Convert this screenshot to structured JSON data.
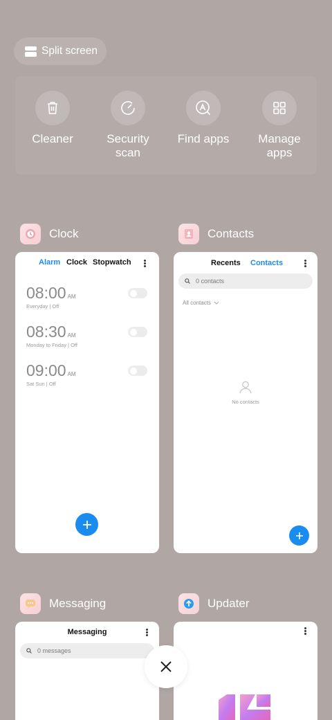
{
  "split_screen": {
    "label": "Split screen"
  },
  "tools": [
    {
      "icon": "trash-icon",
      "label": "Cleaner"
    },
    {
      "icon": "speedometer-icon",
      "label": "Security\nscan"
    },
    {
      "icon": "find-apps-icon",
      "label": "Find apps"
    },
    {
      "icon": "grid-icon",
      "label": "Manage\napps"
    }
  ],
  "apps": {
    "clock": {
      "name": "Clock",
      "tabs": [
        "Alarm",
        "Clock",
        "Stopwatch"
      ],
      "alarms": [
        {
          "time": "08:00",
          "ampm": "AM",
          "repeat": "Everyday",
          "state": "Off"
        },
        {
          "time": "08:30",
          "ampm": "AM",
          "repeat": "Monday to Friday",
          "state": "Off"
        },
        {
          "time": "09:00",
          "ampm": "AM",
          "repeat": "Sat Sun",
          "state": "Off"
        }
      ]
    },
    "contacts": {
      "name": "Contacts",
      "tabs": [
        "Recents",
        "Contacts"
      ],
      "search_placeholder": "0 contacts",
      "filter": "All contacts",
      "empty_text": "No contacts"
    },
    "messaging": {
      "name": "Messaging",
      "title": "Messaging",
      "search_placeholder": "0 messages"
    },
    "updater": {
      "name": "Updater"
    }
  },
  "colors": {
    "background": "#b0a6a4",
    "accent": "#1a8cf0",
    "card": "#ffffff"
  }
}
